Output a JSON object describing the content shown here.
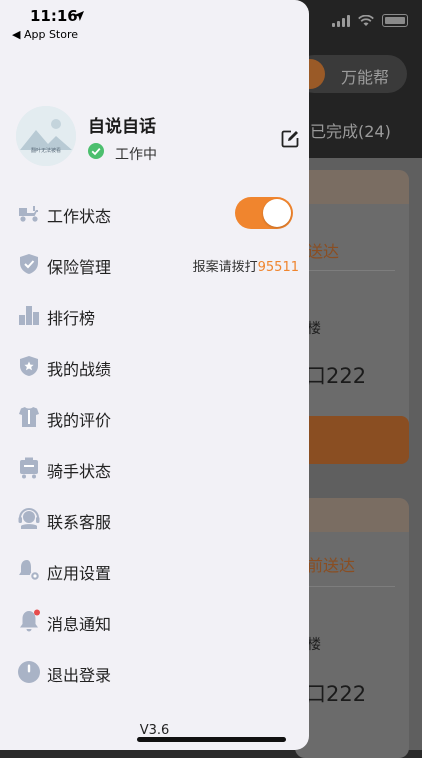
{
  "status_bar": {
    "time": "11:16",
    "back_label": "◀ App Store"
  },
  "background": {
    "top_button": "万能帮",
    "tab_done": "已完成(24)",
    "cards": [
      {
        "status": "送达",
        "floor": "楼",
        "address": "口222"
      },
      {
        "status": "前送达",
        "floor": "楼",
        "address": "口222"
      }
    ]
  },
  "profile": {
    "name": "自说自话",
    "status": "工作中",
    "avatar_caption": "翻叶无法被看"
  },
  "menu": {
    "work_status": "工作状态",
    "insurance": "保险管理",
    "insurance_hint": "报案请拨打",
    "insurance_phone": "95511",
    "ranking": "排行榜",
    "achievements": "我的战绩",
    "reviews": "我的评价",
    "rider_status": "骑手状态",
    "support": "联系客服",
    "settings": "应用设置",
    "notifications": "消息通知",
    "logout": "退出登录"
  },
  "version": "V3.6",
  "colors": {
    "accent": "#f0852e",
    "icon": "#a9b3c6"
  }
}
